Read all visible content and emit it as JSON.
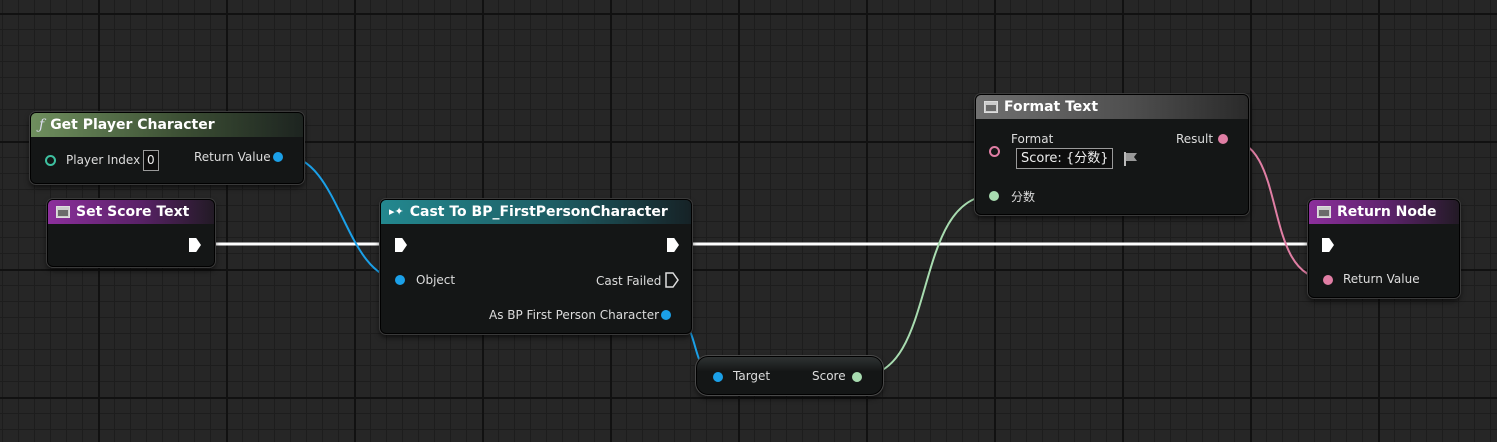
{
  "nodes": {
    "get_player_character": {
      "title": "Get Player Character",
      "player_index_label": "Player Index",
      "player_index_value": "0",
      "return_value_label": "Return Value"
    },
    "set_score_text": {
      "title": "Set Score Text"
    },
    "cast_to": {
      "title": "Cast To BP_FirstPersonCharacter",
      "object_label": "Object",
      "cast_failed_label": "Cast Failed",
      "as_label": "As BP First Person Character"
    },
    "score_getter": {
      "target_label": "Target",
      "score_label": "Score"
    },
    "format_text": {
      "title": "Format Text",
      "format_label": "Format",
      "format_value": "Score: {分数}",
      "result_label": "Result",
      "arg_label": "分数"
    },
    "return_node": {
      "title": "Return Node",
      "return_value_label": "Return Value"
    }
  },
  "colors": {
    "object_pin": "#1ba0e8",
    "text_pin": "#e07ea4",
    "int_pin": "#a8dcb0",
    "struct_pin": "#3ec0a0",
    "exec_wire": "#ffffff"
  },
  "icons": {
    "function": "function-icon",
    "event": "window-icon",
    "cast": "cast-icon"
  }
}
